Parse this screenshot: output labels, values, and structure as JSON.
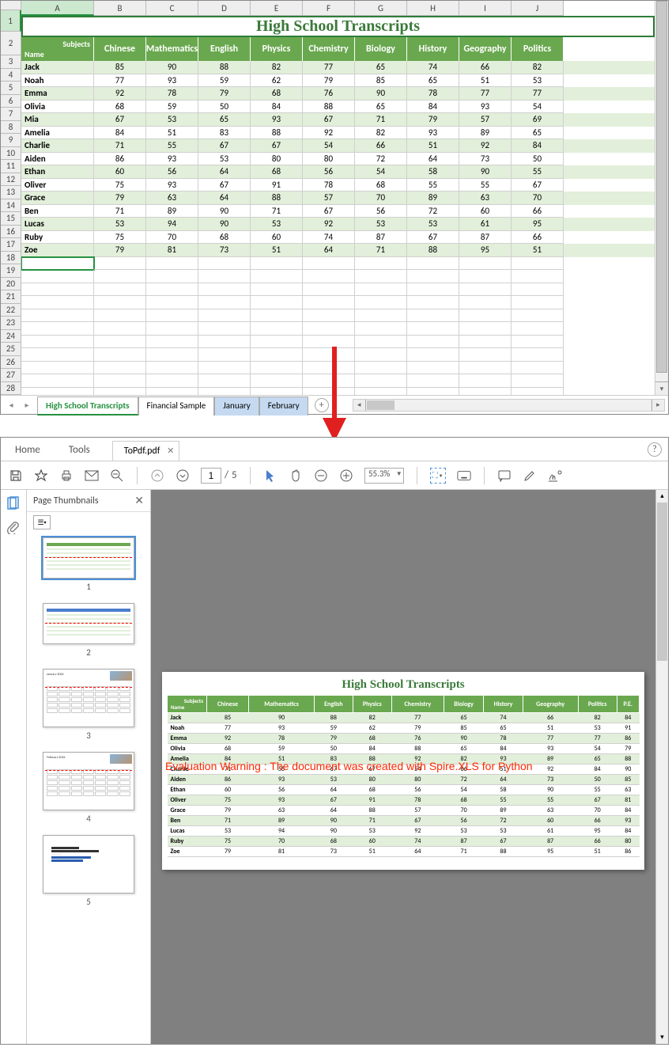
{
  "excel": {
    "title": "High School Transcripts",
    "columns": [
      "A",
      "B",
      "C",
      "D",
      "E",
      "F",
      "G",
      "H",
      "I",
      "J"
    ],
    "row_numbers": [
      1,
      2,
      3,
      4,
      5,
      6,
      7,
      8,
      9,
      10,
      11,
      12,
      13,
      14,
      15,
      16,
      17,
      18,
      19,
      20,
      21,
      22,
      23,
      24,
      25,
      26,
      27,
      28
    ],
    "header_corner_top": "Subjects",
    "header_corner_bottom": "Name",
    "subjects": [
      "Chinese",
      "Mathematics",
      "English",
      "Physics",
      "Chemistry",
      "Biology",
      "History",
      "Geography",
      "Politics"
    ],
    "rows": [
      {
        "name": "Jack",
        "v": [
          85,
          90,
          88,
          82,
          77,
          65,
          74,
          66,
          82
        ]
      },
      {
        "name": "Noah",
        "v": [
          77,
          93,
          59,
          62,
          79,
          85,
          65,
          51,
          53
        ]
      },
      {
        "name": "Emma",
        "v": [
          92,
          78,
          79,
          68,
          76,
          90,
          78,
          77,
          77
        ]
      },
      {
        "name": "Olivia",
        "v": [
          68,
          59,
          50,
          84,
          88,
          65,
          84,
          93,
          54
        ]
      },
      {
        "name": "Mia",
        "v": [
          67,
          53,
          65,
          93,
          67,
          71,
          79,
          57,
          69
        ]
      },
      {
        "name": "Amelia",
        "v": [
          84,
          51,
          83,
          88,
          92,
          82,
          93,
          89,
          65
        ]
      },
      {
        "name": "Charlie",
        "v": [
          71,
          55,
          67,
          67,
          54,
          66,
          51,
          92,
          84
        ]
      },
      {
        "name": "Aiden",
        "v": [
          86,
          93,
          53,
          80,
          80,
          72,
          64,
          73,
          50
        ]
      },
      {
        "name": "Ethan",
        "v": [
          60,
          56,
          64,
          68,
          56,
          54,
          58,
          90,
          55
        ]
      },
      {
        "name": "Oliver",
        "v": [
          75,
          93,
          67,
          91,
          78,
          68,
          55,
          55,
          67
        ]
      },
      {
        "name": "Grace",
        "v": [
          79,
          63,
          64,
          88,
          57,
          70,
          89,
          63,
          70
        ]
      },
      {
        "name": "Ben",
        "v": [
          71,
          89,
          90,
          71,
          67,
          56,
          72,
          60,
          66
        ]
      },
      {
        "name": "Lucas",
        "v": [
          53,
          94,
          90,
          53,
          92,
          53,
          53,
          61,
          95
        ]
      },
      {
        "name": "Ruby",
        "v": [
          75,
          70,
          68,
          60,
          74,
          87,
          67,
          87,
          66
        ]
      },
      {
        "name": "Zoe",
        "v": [
          79,
          81,
          73,
          51,
          64,
          71,
          88,
          95,
          51
        ]
      }
    ],
    "sheets": [
      {
        "name": "High School Transcripts",
        "state": "active"
      },
      {
        "name": "Financial Sample",
        "state": "normal"
      },
      {
        "name": "January",
        "state": "selected"
      },
      {
        "name": "February",
        "state": "selected"
      }
    ],
    "add_sheet": "+"
  },
  "pdf": {
    "tabs": {
      "home": "Home",
      "tools": "Tools"
    },
    "file_tab": "ToPdf.pdf",
    "page_current": "1",
    "page_sep": "/",
    "page_total": "5",
    "zoom": "55.3%",
    "thumbs_title": "Page Thumbnails",
    "thumbnails": [
      {
        "num": "1",
        "type": "table-wide"
      },
      {
        "num": "2",
        "type": "table-wide-blue"
      },
      {
        "num": "3",
        "type": "calendar",
        "label": "January 2024"
      },
      {
        "num": "4",
        "type": "calendar",
        "label": "February 2024"
      },
      {
        "num": "5",
        "type": "text"
      }
    ],
    "page_title": "High School Transcripts",
    "subjects_extra": "P.E.",
    "rows_pe": [
      84,
      91,
      86,
      79,
      88,
      90,
      85,
      63,
      81,
      84,
      93,
      84,
      80,
      86
    ],
    "rows_mia_idx_skip": true,
    "warning": "Evaluation Warning : The document was created with  Spire.XLS for Python"
  }
}
